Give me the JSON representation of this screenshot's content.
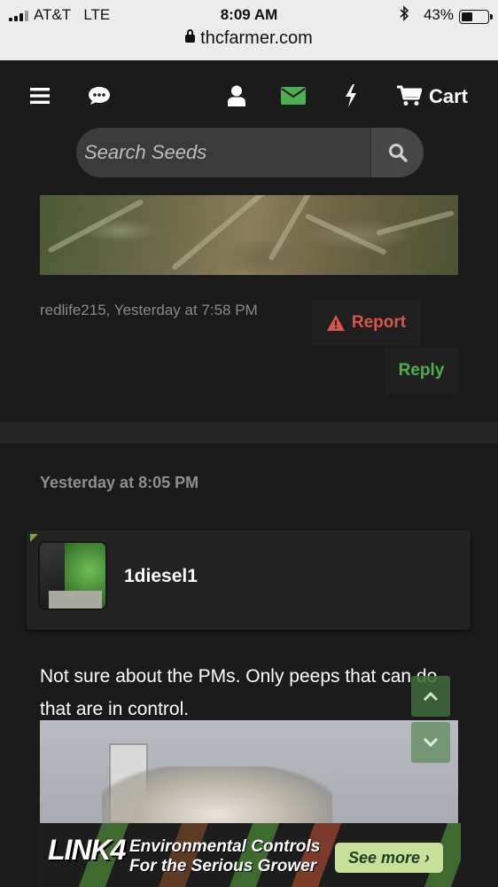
{
  "status_bar": {
    "carrier": "AT&T",
    "network": "LTE",
    "time": "8:09 AM",
    "battery": "43%",
    "battery_level": 0.43
  },
  "browser": {
    "url": "thcfarmer.com"
  },
  "nav": {
    "cart_label": "Cart",
    "icons": [
      "menu-icon",
      "chat-icon",
      "user-icon",
      "mail-icon",
      "bolt-icon",
      "cart-icon"
    ],
    "mail_color": "#4caf50"
  },
  "search": {
    "placeholder": "Search Seeds"
  },
  "previous_post": {
    "meta": "redlife215, Yesterday at 7:58 PM",
    "report_label": "Report",
    "reply_label": "Reply",
    "report_color": "#d9534f",
    "reply_color": "#4fae4f"
  },
  "post": {
    "date": "Yesterday at 8:05 PM",
    "username": "1diesel1",
    "text": "Not sure about the PMs. Only peeps that can do that are in control."
  },
  "ad": {
    "logo": "LINK4",
    "line1": "Environmental Controls",
    "line2": "For the Serious Grower",
    "button": "See more ›"
  }
}
